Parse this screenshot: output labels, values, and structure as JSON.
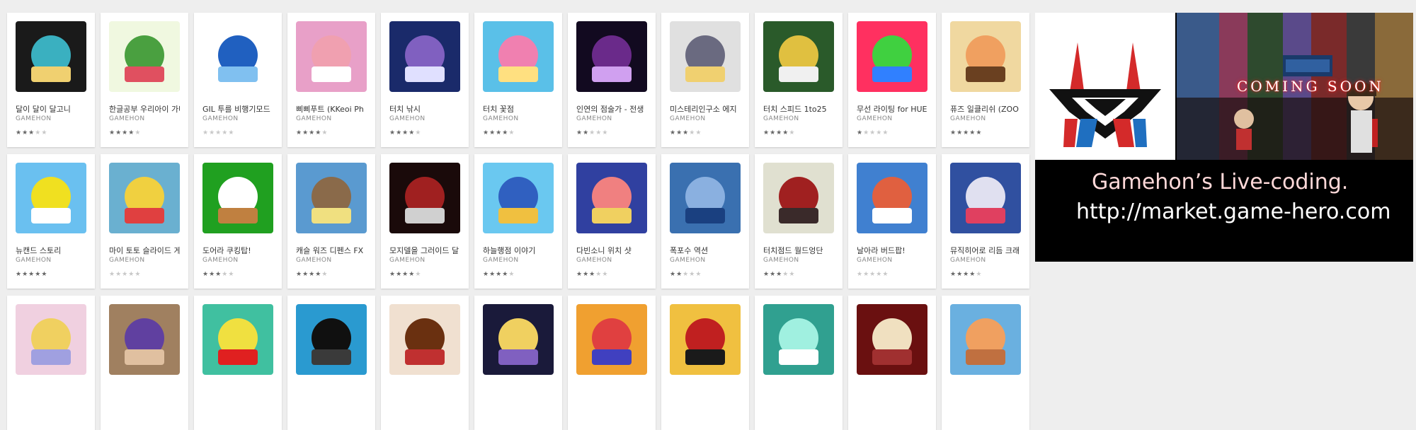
{
  "rows": [
    [
      {
        "title": "달이 달이 달고니",
        "developer": "GAMEHON",
        "rating": 3,
        "icon": "anime-girl-gold-icon"
      },
      {
        "title": "한글공부 우리아이 가나다",
        "developer": "GAMEHON",
        "rating": 4,
        "icon": "korean-letters-icon"
      },
      {
        "title": "GIL 투를 비행기모드",
        "developer": "GAMEHON",
        "rating": 0,
        "icon": "blue-helicopter-icon"
      },
      {
        "title": "삐삐푸트 (KKeoi Ph",
        "developer": "GAMEHON",
        "rating": 4,
        "icon": "teddy-bear-icon"
      },
      {
        "title": "터치 낚시",
        "developer": "GAMEHON",
        "rating": 4,
        "icon": "touch-fishing-icon"
      },
      {
        "title": "터치 꽃점",
        "developer": "GAMEHON",
        "rating": 4,
        "icon": "pink-flower-icon"
      },
      {
        "title": "인연의 점술가 - 전생",
        "developer": "GAMEHON",
        "rating": 1.5,
        "icon": "fortune-teller-icon"
      },
      {
        "title": "미스테리인구소 에지",
        "developer": "GAMEHON",
        "rating": 3,
        "icon": "mystery-characters-icon"
      },
      {
        "title": "터치 스피드 1to25",
        "developer": "GAMEHON",
        "rating": 4,
        "icon": "touch-speed-icon"
      },
      {
        "title": "무선 라이팅 for HUE",
        "developer": "GAMEHON",
        "rating": 1,
        "icon": "rainbow-bulbs-icon"
      },
      {
        "title": "퓨즈 일클리쉬 (ZOO",
        "developer": "GAMEHON",
        "rating": 5,
        "icon": "hat-girl-icon"
      }
    ],
    [
      {
        "title": "뉴캔드 스토리",
        "developer": "GAMEHON",
        "rating": 4.5,
        "icon": "yellow-bird-icon"
      },
      {
        "title": "마이 토토 슬라이드 게",
        "developer": "GAMEHON",
        "rating": 0,
        "icon": "slide-robot-girl-icon"
      },
      {
        "title": "도어라 쿠킹탑!",
        "developer": "GAMEHON",
        "rating": 3,
        "icon": "chef-bear-icon"
      },
      {
        "title": "캐슬 워즈 디펜스 FX",
        "developer": "GAMEHON",
        "rating": 4,
        "icon": "castle-wars-icon"
      },
      {
        "title": "모지델을 그러이드 달",
        "developer": "GAMEHON",
        "rating": 3.5,
        "icon": "grave-run-icon"
      },
      {
        "title": "하늘행점 이야기",
        "developer": "GAMEHON",
        "rating": 4,
        "icon": "hot-air-balloon-icon"
      },
      {
        "title": "다빈소니 위치 샷",
        "developer": "GAMEHON",
        "rating": 3,
        "icon": "anime-cat-girl-icon"
      },
      {
        "title": "폭포수 역션",
        "developer": "GAMEHON",
        "rating": 2,
        "icon": "waterfall-icon"
      },
      {
        "title": "터치점드 월드엉단",
        "developer": "GAMEHON",
        "rating": 3,
        "icon": "red-hair-boy-icon"
      },
      {
        "title": "날아라 버드팝!",
        "developer": "GAMEHON",
        "rating": 0,
        "icon": "birdpop-icon"
      },
      {
        "title": "뮤직히어로 리듬 크래",
        "developer": "GAMEHON",
        "rating": 3.5,
        "icon": "rhythm-crasher-icon"
      }
    ],
    [
      {
        "icon": "blonde-girl-icon"
      },
      {
        "icon": "purple-hair-girl-icon"
      },
      {
        "icon": "lotto-icon"
      },
      {
        "icon": "black-gem-icon"
      },
      {
        "icon": "brown-hair-girl-icon"
      },
      {
        "icon": "moon-puzzle-icon"
      },
      {
        "icon": "orange-puzzle-icon"
      },
      {
        "icon": "red-boy-icon"
      },
      {
        "icon": "cardfind-plus-icon"
      },
      {
        "icon": "card-find-icon"
      },
      {
        "icon": "bread-bakery-icon"
      }
    ]
  ],
  "banner": {
    "coming_soon": "COMING SOON",
    "line1": "Gamehon’s Live-coding.",
    "line2": "http://market.game-hero.com",
    "colors": {
      "logo_red": "#d42a2a",
      "logo_blue": "#1f6fc0",
      "coming_glow": "#ff3030"
    }
  },
  "colors": {
    "background": "#eeeeee",
    "card": "#ffffff",
    "star_on": "#666666",
    "star_off": "#c8c8c8"
  }
}
